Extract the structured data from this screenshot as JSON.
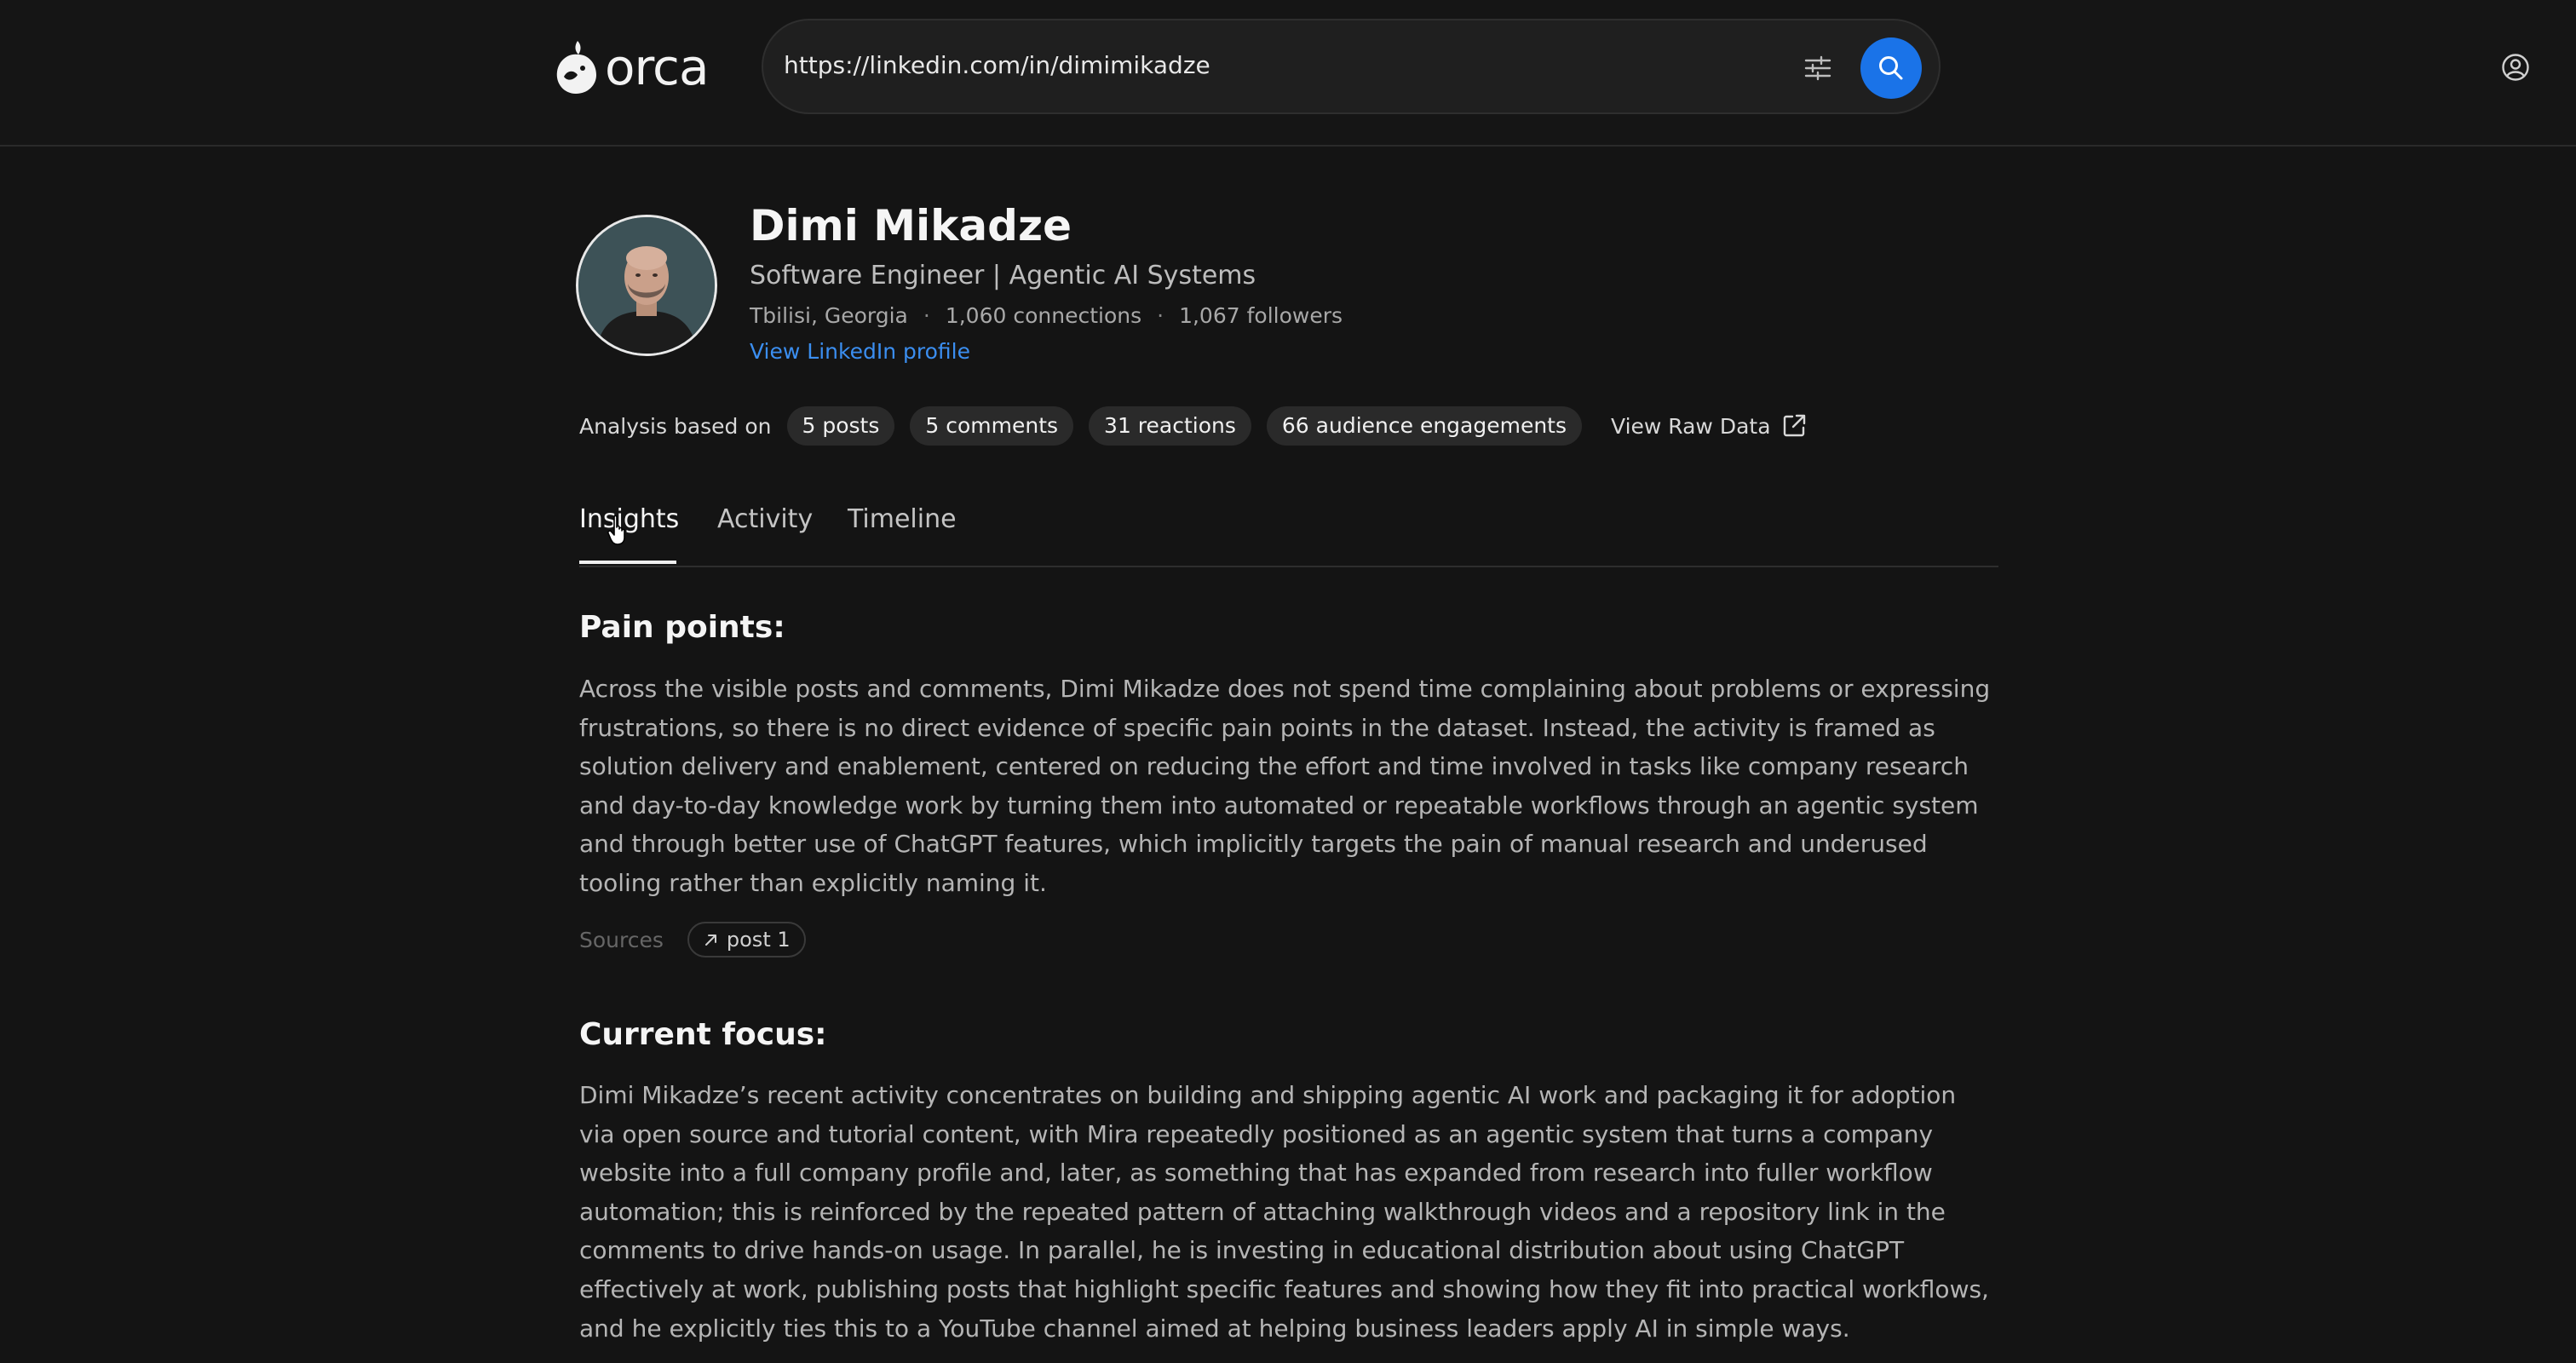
{
  "header": {
    "logo_text": "orca",
    "search_value": "https://linkedin.com/in/dimimikadze",
    "icons": [
      "filter-icon",
      "search-icon",
      "account-icon"
    ]
  },
  "profile": {
    "name": "Dimi Mikadze",
    "headline": "Software Engineer | Agentic AI Systems",
    "location": "Tbilisi, Georgia",
    "connections": "1,060 connections",
    "followers": "1,067 followers",
    "separator": "·",
    "link_label": "View LinkedIn profile"
  },
  "analysis": {
    "label": "Analysis based on",
    "pills": [
      "5 posts",
      "5 comments",
      "31 reactions",
      "66 audience engagements"
    ],
    "raw_data_label": "View Raw Data"
  },
  "tabs": [
    {
      "label": "Insights",
      "active": true
    },
    {
      "label": "Activity",
      "active": false
    },
    {
      "label": "Timeline",
      "active": false
    }
  ],
  "sections": [
    {
      "title": "Pain points:",
      "lines": [
        "Across the visible posts and comments, Dimi Mikadze does not spend time complaining about problems or expressing",
        "frustrations, so there is no direct evidence of specific pain points in the dataset. Instead, the activity is framed as",
        "solution delivery and enablement, centered on reducing the effort and time involved in tasks like company research",
        "and day-to-day knowledge work by turning them into automated or repeatable workflows through an agentic system",
        "and through better use of ChatGPT features, which implicitly targets the pain of manual research and underused",
        "tooling rather than explicitly naming it."
      ],
      "sources_label": "Sources",
      "sources": [
        "post 1"
      ]
    },
    {
      "title": "Current focus:",
      "lines": [
        "Dimi Mikadze’s recent activity concentrates on building and shipping agentic AI work and packaging it for adoption",
        "via open source and tutorial content, with Mira repeatedly positioned as an agentic system that turns a company",
        "website into a full company profile and, later, as something that has expanded from research into fuller workflow",
        "automation; this is reinforced by the repeated pattern of attaching walkthrough videos and a repository link in the",
        "comments to drive hands-on usage. In parallel, he is investing in educational distribution about using ChatGPT",
        "effectively at work, publishing posts that highlight specific features and showing how they fit into practical workflows,",
        "and he explicitly ties this to a YouTube channel aimed at helping business leaders apply AI in simple ways."
      ]
    }
  ],
  "colors": {
    "background": "#141414",
    "accent": "#1a73e8",
    "link": "#3b8ef0"
  }
}
